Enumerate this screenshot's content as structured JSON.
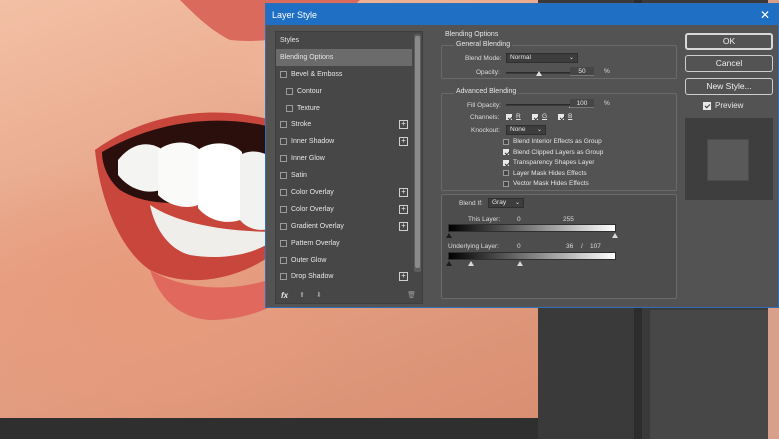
{
  "dialog": {
    "title": "Layer Style",
    "close_glyph": "✕"
  },
  "styles_panel": {
    "items": [
      {
        "label": "Styles",
        "header": true
      },
      {
        "label": "Blending Options",
        "selected": true
      },
      {
        "label": "Bevel & Emboss",
        "checkbox": true
      },
      {
        "label": "Contour",
        "checkbox": true,
        "indent": true
      },
      {
        "label": "Texture",
        "checkbox": true,
        "indent": true
      },
      {
        "label": "Stroke",
        "checkbox": true,
        "plus": true
      },
      {
        "label": "Inner Shadow",
        "checkbox": true,
        "plus": true
      },
      {
        "label": "Inner Glow",
        "checkbox": true
      },
      {
        "label": "Satin",
        "checkbox": true
      },
      {
        "label": "Color Overlay",
        "checkbox": true,
        "plus": true
      },
      {
        "label": "Color Overlay",
        "checkbox": true,
        "plus": true
      },
      {
        "label": "Gradient Overlay",
        "checkbox": true,
        "plus": true
      },
      {
        "label": "Pattern Overlay",
        "checkbox": true
      },
      {
        "label": "Outer Glow",
        "checkbox": true
      },
      {
        "label": "Drop Shadow",
        "checkbox": true,
        "plus": true
      }
    ],
    "footer": {
      "fx_label": "fx",
      "icons": [
        "fx-menu-icon",
        "move-up-icon",
        "move-down-icon",
        "trash-icon"
      ]
    }
  },
  "blending": {
    "section_title": "Blending Options",
    "general": {
      "title": "General Blending",
      "blend_mode_label": "Blend Mode:",
      "blend_mode_value": "Normal",
      "opacity_label": "Opacity:",
      "opacity_value": "50",
      "opacity_unit": "%",
      "opacity_fraction": 0.5
    },
    "advanced": {
      "title": "Advanced Blending",
      "fill_opacity_label": "Fill Opacity:",
      "fill_opacity_value": "100",
      "fill_opacity_unit": "%",
      "fill_opacity_fraction": 1.0,
      "channels_label": "Channels:",
      "channels": [
        {
          "label": "R",
          "checked": true
        },
        {
          "label": "G",
          "checked": true
        },
        {
          "label": "B",
          "checked": true
        }
      ],
      "knockout_label": "Knockout:",
      "knockout_value": "None",
      "options": [
        {
          "label": "Blend Interior Effects as Group",
          "checked": false
        },
        {
          "label": "Blend Clipped Layers as Group",
          "checked": true
        },
        {
          "label": "Transparency Shapes Layer",
          "checked": true
        },
        {
          "label": "Layer Mask Hides Effects",
          "checked": false
        },
        {
          "label": "Vector Mask Hides Effects",
          "checked": false
        }
      ]
    },
    "blend_if": {
      "label": "Blend If:",
      "value": "Gray",
      "this_layer_label": "This Layer:",
      "this_layer_low": "0",
      "this_layer_high": "255",
      "underlying_label": "Underlying Layer:",
      "underlying_low": "0",
      "underlying_split_a": "36",
      "underlying_separator": "/",
      "underlying_split_b": "107"
    }
  },
  "buttons": {
    "ok": "OK",
    "cancel": "Cancel",
    "new_style": "New Style...",
    "preview_label": "Preview",
    "preview_checked": true
  },
  "colors": {
    "titlebar": "#1f6fc4",
    "dialog_bg": "#535353",
    "panel_bg": "#474747"
  }
}
